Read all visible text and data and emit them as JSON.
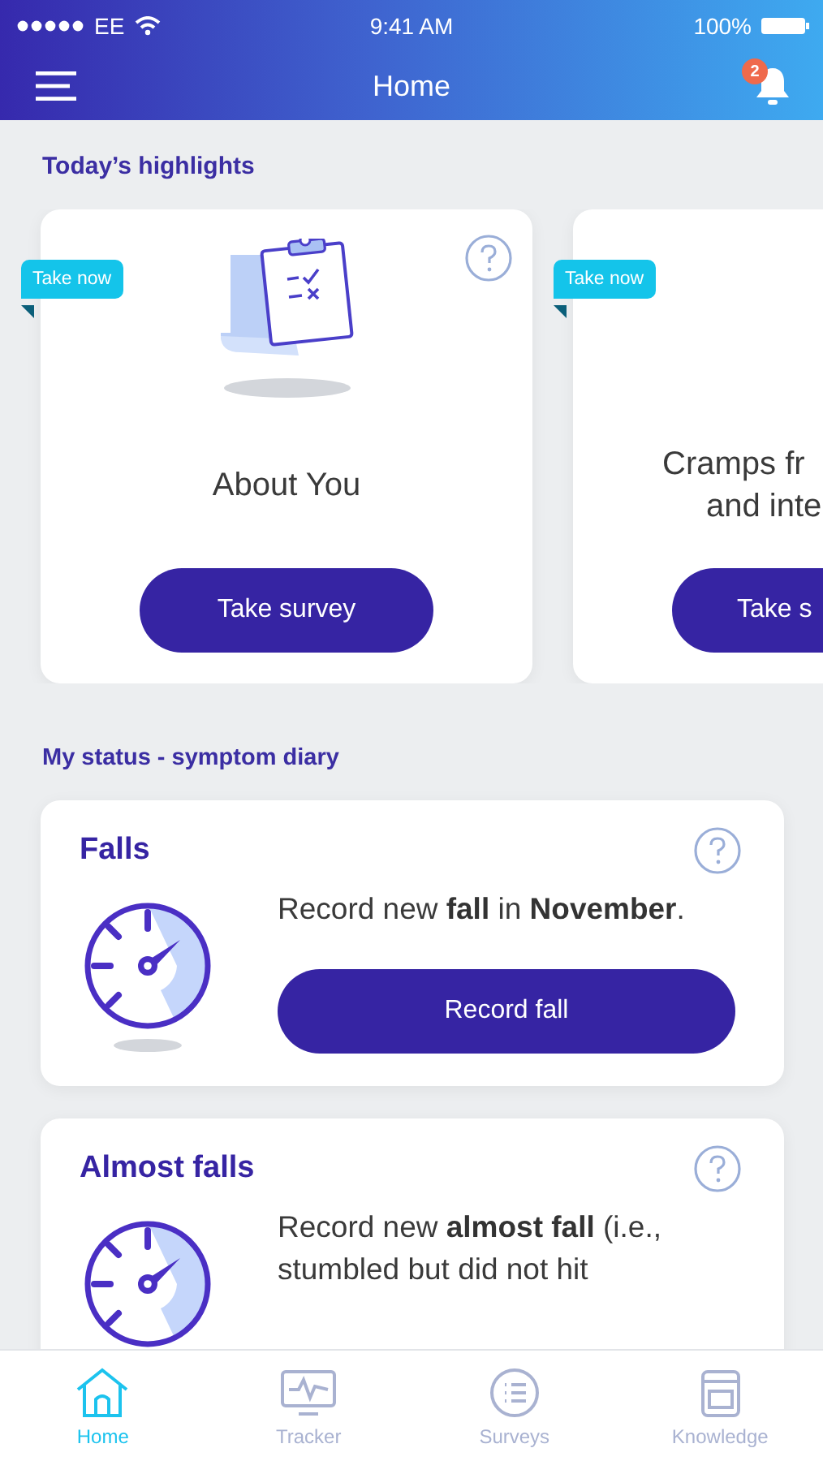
{
  "status_bar": {
    "carrier": "EE",
    "time": "9:41 AM",
    "battery": "100%"
  },
  "nav": {
    "title": "Home",
    "notification_count": "2"
  },
  "highlights": {
    "heading": "Today’s highlights",
    "cards": [
      {
        "badge": "Take now",
        "title_lines": [
          "About You"
        ],
        "button": "Take survey",
        "illustration": true
      },
      {
        "badge": "Take now",
        "title_lines": [
          "Cramps fr",
          "and inte"
        ],
        "button": "Take s",
        "illustration": false
      }
    ]
  },
  "diary": {
    "heading": "My status - symptom diary",
    "cards": [
      {
        "title": "Falls",
        "text": "Record new **fall** in **November**.",
        "button": "Record fall"
      },
      {
        "title": "Almost falls",
        "text": "Record new **almost fall** (i.e., stumbled but did not hit"
      }
    ]
  },
  "tabs": [
    {
      "label": "Home",
      "selected": true
    },
    {
      "label": "Tracker",
      "selected": false
    },
    {
      "label": "Surveys",
      "selected": false
    },
    {
      "label": "Knowledge",
      "selected": false
    }
  ]
}
